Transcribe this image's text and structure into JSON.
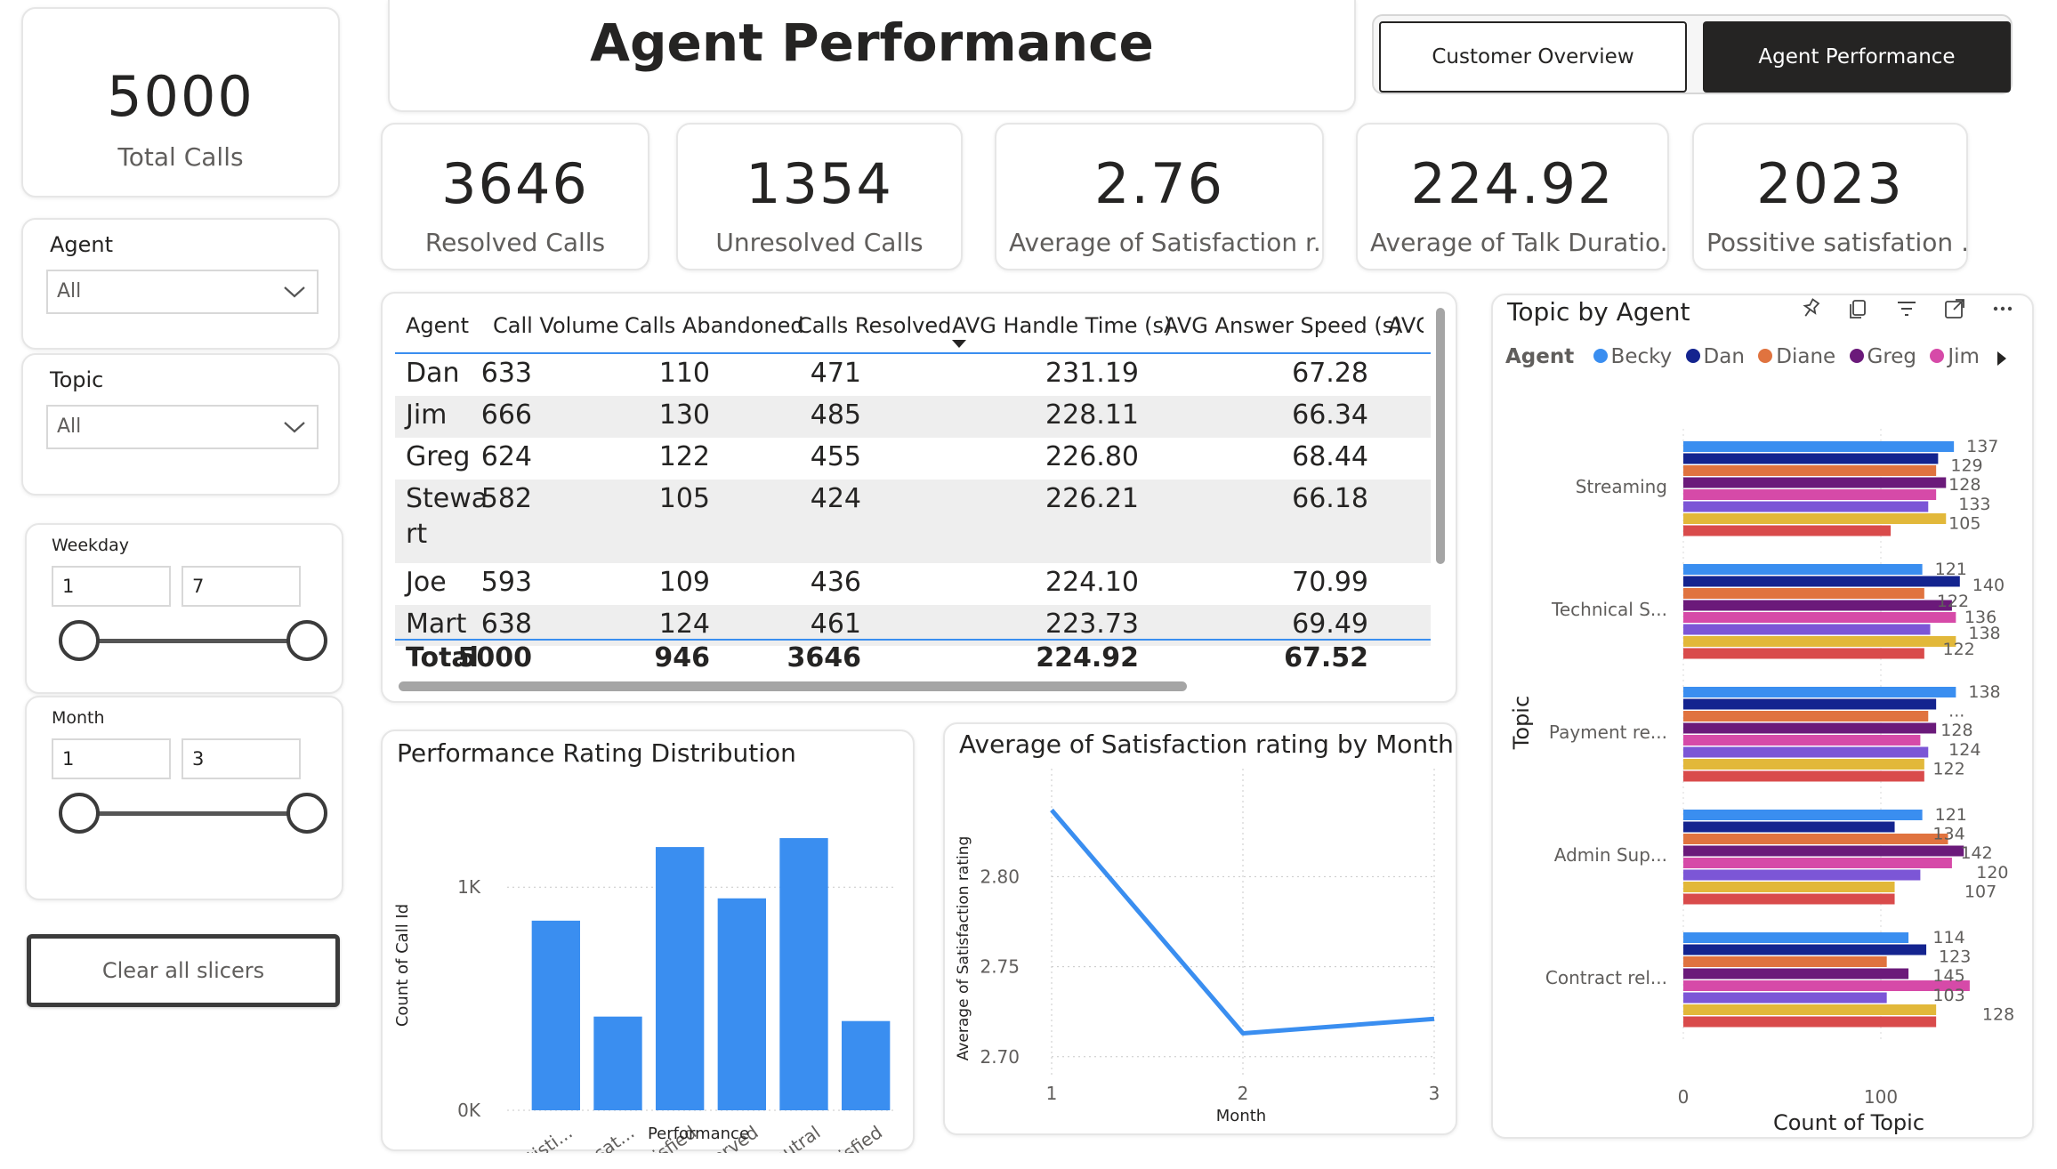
{
  "kpi_total": {
    "value": "5000",
    "label": "Total Calls"
  },
  "header": {
    "title": "Agent Performance"
  },
  "nav": {
    "customer_overview": "Customer Overview",
    "agent_performance": "Agent Performance"
  },
  "kpis": [
    {
      "value": "3646",
      "label": "Resolved Calls"
    },
    {
      "value": "1354",
      "label": "Unresolved Calls"
    },
    {
      "value": "2.76",
      "label": "Average of Satisfaction r..."
    },
    {
      "value": "224.92",
      "label": "Average of Talk Duratio..."
    },
    {
      "value": "2023",
      "label": "Possitive satisfation ..."
    }
  ],
  "slicers": {
    "agent": {
      "title": "Agent",
      "value": "All"
    },
    "topic": {
      "title": "Topic",
      "value": "All"
    },
    "weekday": {
      "title": "Weekday",
      "min": "1",
      "max": "7"
    },
    "month": {
      "title": "Month",
      "min": "1",
      "max": "3"
    },
    "clear_button": "Clear all slicers"
  },
  "table": {
    "headers": [
      "Agent",
      "Call Volume",
      "Calls Abandoned",
      "Calls Resolved",
      "AVG Handle Time (s)",
      "AVG Answer Speed (s)",
      "AVG"
    ],
    "rows": [
      {
        "agent": "Dan",
        "agent2": "",
        "volume": "633",
        "abandoned": "110",
        "resolved": "471",
        "handle": "231.19",
        "speed": "67.28"
      },
      {
        "agent": "Jim",
        "agent2": "",
        "volume": "666",
        "abandoned": "130",
        "resolved": "485",
        "handle": "228.11",
        "speed": "66.34"
      },
      {
        "agent": "Greg",
        "agent2": "",
        "volume": "624",
        "abandoned": "122",
        "resolved": "455",
        "handle": "226.80",
        "speed": "68.44"
      },
      {
        "agent": "Stewa",
        "agent2": "rt",
        "volume": "582",
        "abandoned": "105",
        "resolved": "424",
        "handle": "226.21",
        "speed": "66.18"
      },
      {
        "agent": "Joe",
        "agent2": "",
        "volume": "593",
        "abandoned": "109",
        "resolved": "436",
        "handle": "224.10",
        "speed": "70.99"
      },
      {
        "agent": "Mart",
        "agent2": "",
        "volume": "638",
        "abandoned": "124",
        "resolved": "461",
        "handle": "223.73",
        "speed": "69.49"
      }
    ],
    "total": {
      "agent": "Total",
      "volume": "5000",
      "abandoned": "946",
      "resolved": "3646",
      "handle": "224.92",
      "speed": "67.52"
    }
  },
  "colors": {
    "accent_blue": "#3a8ef0",
    "becky": "#3a8ef0",
    "dan": "#14248f",
    "diane": "#e0733f",
    "greg": "#6b1a7a",
    "jim": "#d64aa8",
    "s6": "#7c56d6",
    "s7": "#e2b83a",
    "s8": "#d94b4b"
  },
  "chart_data": [
    {
      "type": "bar",
      "title": "Performance Rating Distribution",
      "xlabel": "Performance",
      "ylabel": "Count of Call Id",
      "categories": [
        "Very Satisti...",
        "Very Dissat...",
        "Satisfied",
        "Not Served",
        "Neutral",
        "Dissatisfied"
      ],
      "values": [
        850,
        420,
        1180,
        950,
        1220,
        400
      ],
      "yticks": [
        "0K",
        "1K"
      ],
      "ylim": [
        0,
        1300
      ]
    },
    {
      "type": "line",
      "title": "Average of Satisfaction rating by Month",
      "xlabel": "Month",
      "ylabel": "Average of Satisfaction rating",
      "x": [
        1,
        2,
        3
      ],
      "values": [
        2.837,
        2.713,
        2.721
      ],
      "yticks": [
        "2.70",
        "2.75",
        "2.80"
      ],
      "ylim": [
        2.69,
        2.86
      ]
    },
    {
      "type": "bar",
      "orientation": "horizontal",
      "title": "Topic by Agent",
      "xlabel": "Count of Topic",
      "ylabel": "Topic",
      "legend_title": "Agent",
      "legend": [
        "Becky",
        "Dan",
        "Diane",
        "Greg",
        "Jim"
      ],
      "legend_position": "top-left",
      "xticks": [
        "0",
        "100"
      ],
      "xlim": [
        0,
        150
      ],
      "categories": [
        "Streaming",
        "Technical S...",
        "Payment re...",
        "Admin Sup...",
        "Contract rel..."
      ],
      "series": [
        {
          "name": "Becky",
          "values": [
            137,
            121,
            138,
            121,
            114
          ]
        },
        {
          "name": "Dan",
          "values": [
            129,
            140,
            128,
            107,
            123
          ]
        },
        {
          "name": "Diane",
          "values": [
            128,
            122,
            124,
            134,
            103
          ]
        },
        {
          "name": "Greg",
          "values": [
            133,
            136,
            128,
            142,
            114
          ]
        },
        {
          "name": "Jim",
          "values": [
            128,
            138,
            120,
            136,
            145
          ]
        },
        {
          "values": [
            124,
            125,
            124,
            120,
            103
          ]
        },
        {
          "values": [
            133,
            138,
            122,
            107,
            128
          ]
        },
        {
          "values": [
            105,
            122,
            122,
            107,
            128
          ]
        }
      ],
      "data_labels": [
        [
          "137",
          "129",
          "128",
          "133",
          "105"
        ],
        [
          "121",
          "140",
          "122",
          "136",
          "138",
          "122"
        ],
        [
          "138",
          "...",
          "128",
          "124",
          "122"
        ],
        [
          "121",
          "134",
          "142",
          "120",
          "107"
        ],
        [
          "114",
          "123",
          "145",
          "103",
          "128"
        ]
      ]
    }
  ]
}
